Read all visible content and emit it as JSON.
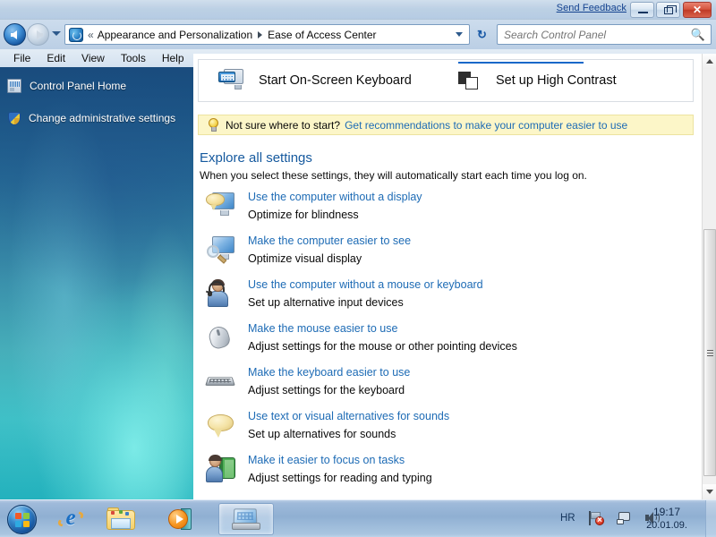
{
  "titlebar": {
    "send_feedback": "Send Feedback",
    "minimize_label": "Minimize",
    "maximize_label": "Restore",
    "close_label": "Close",
    "close_glyph": "✕"
  },
  "nav": {
    "back_label": "Back",
    "forward_label": "Forward",
    "recent_pages_label": "Recent pages",
    "double_chevron": "«",
    "breadcrumbs": [
      {
        "label": "Appearance and Personalization"
      },
      {
        "label": "Ease of Access Center"
      }
    ],
    "address_dropdown_label": "Previous locations",
    "refresh_glyph": "↻",
    "refresh_label": "Refresh"
  },
  "search": {
    "placeholder": "Search Control Panel",
    "value": "",
    "icon": "search-icon"
  },
  "menubar": {
    "items": [
      {
        "label": "File"
      },
      {
        "label": "Edit"
      },
      {
        "label": "View"
      },
      {
        "label": "Tools"
      },
      {
        "label": "Help"
      }
    ]
  },
  "sidebar": {
    "items": [
      {
        "label": "Control Panel Home",
        "icon": "control-panel-home-icon"
      },
      {
        "label": "Change administrative settings",
        "icon": "shield-icon"
      }
    ]
  },
  "quick_actions": {
    "buttons": [
      {
        "label": "Start On-Screen Keyboard",
        "icon": "on-screen-keyboard-icon"
      },
      {
        "label": "Set up High Contrast",
        "icon": "high-contrast-icon",
        "focused": true
      }
    ]
  },
  "tip": {
    "icon": "lightbulb-icon",
    "question": "Not sure where to start?",
    "link": "Get recommendations to make your computer easier to use"
  },
  "explore": {
    "title": "Explore all settings",
    "subtitle": "When you select these settings, they will automatically start each time you log on."
  },
  "settings": [
    {
      "icon": "monitor-speech-icon",
      "link": "Use the computer without a display",
      "desc": "Optimize for blindness"
    },
    {
      "icon": "monitor-magnifier-icon",
      "link": "Make the computer easier to see",
      "desc": "Optimize visual display"
    },
    {
      "icon": "person-headset-icon",
      "link": "Use the computer without a mouse or keyboard",
      "desc": "Set up alternative input devices"
    },
    {
      "icon": "mouse-icon",
      "link": "Make the mouse easier to use",
      "desc": "Adjust settings for the mouse or other pointing devices"
    },
    {
      "icon": "keyboard-icon",
      "link": "Make the keyboard easier to use",
      "desc": "Adjust settings for the keyboard"
    },
    {
      "icon": "speech-bubble-icon",
      "link": "Use text or visual alternatives for sounds",
      "desc": "Set up alternatives for sounds"
    },
    {
      "icon": "person-book-icon",
      "link": "Make it easier to focus on tasks",
      "desc": "Adjust settings for reading and typing"
    }
  ],
  "scrollbar": {
    "up_label": "Scroll up",
    "down_label": "Scroll down",
    "thumb_label": "Scroll thumb"
  },
  "taskbar": {
    "start_label": "Start",
    "items": [
      {
        "label": "Internet Explorer",
        "icon": "internet-explorer-icon"
      },
      {
        "label": "Windows Explorer",
        "icon": "folder-icon"
      },
      {
        "label": "Windows Media Player",
        "icon": "media-player-icon"
      },
      {
        "label": "Ease of Access Center",
        "icon": "control-panel-icon",
        "active": true
      }
    ],
    "tray": {
      "language": "HR",
      "icons": [
        {
          "name": "network-flag-error-icon",
          "label": "Action Center"
        },
        {
          "name": "network-icon",
          "label": "Network"
        },
        {
          "name": "volume-icon",
          "label": "Volume"
        }
      ],
      "time": "19:17",
      "date": "20.01.09."
    },
    "show_desktop_label": "Show desktop"
  },
  "colors": {
    "accent": "#1868c9",
    "link": "#1d6bb5",
    "heading": "#15599e",
    "tip_bg": "#fcf6c8",
    "close_button": "#bf3a26"
  }
}
